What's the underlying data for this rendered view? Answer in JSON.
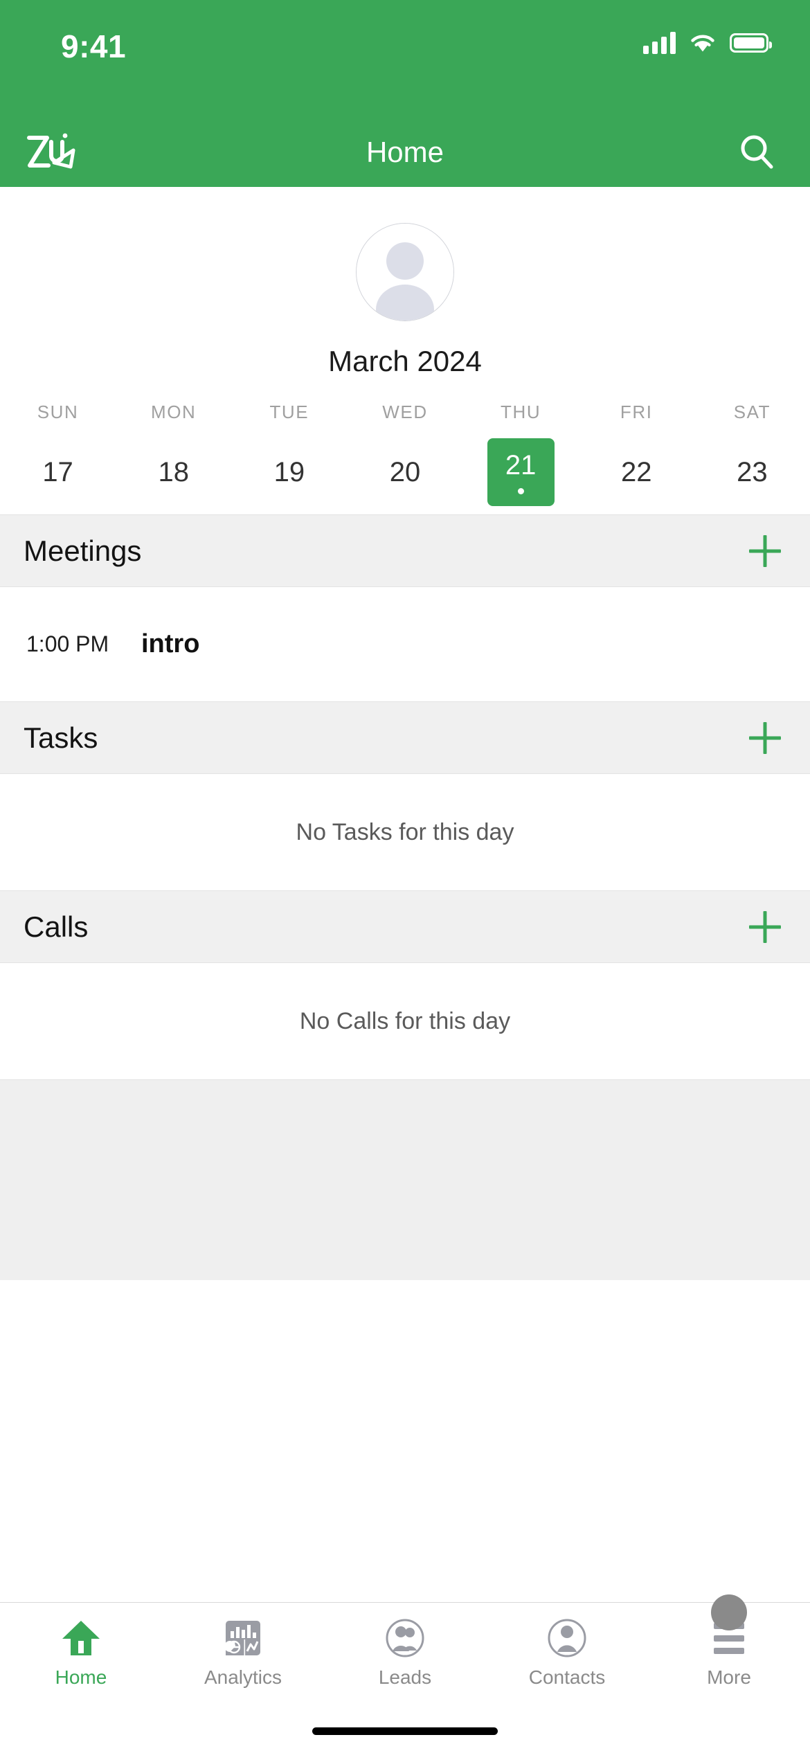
{
  "status_bar": {
    "time": "9:41",
    "cellular_icon": "cellular-signal-icon",
    "wifi_icon": "wifi-icon",
    "battery_icon": "battery-icon"
  },
  "nav": {
    "logo_name": "zia-logo",
    "title": "Home",
    "search_icon": "search-icon"
  },
  "profile": {
    "avatar_name": "default-user-avatar"
  },
  "calendar": {
    "month_label": "March 2024",
    "weekdays": [
      "SUN",
      "MON",
      "TUE",
      "WED",
      "THU",
      "FRI",
      "SAT"
    ],
    "days": [
      {
        "date": "17",
        "selected": false,
        "has_event": false
      },
      {
        "date": "18",
        "selected": false,
        "has_event": false
      },
      {
        "date": "19",
        "selected": false,
        "has_event": false
      },
      {
        "date": "20",
        "selected": false,
        "has_event": false
      },
      {
        "date": "21",
        "selected": true,
        "has_event": true
      },
      {
        "date": "22",
        "selected": false,
        "has_event": false
      },
      {
        "date": "23",
        "selected": false,
        "has_event": false
      }
    ]
  },
  "sections": {
    "meetings": {
      "title": "Meetings",
      "add_label": "+",
      "items": [
        {
          "time": "1:00 PM",
          "title": "intro"
        }
      ]
    },
    "tasks": {
      "title": "Tasks",
      "add_label": "+",
      "empty_text": "No Tasks for this day"
    },
    "calls": {
      "title": "Calls",
      "add_label": "+",
      "empty_text": "No Calls for this day"
    }
  },
  "tabbar": {
    "items": [
      {
        "label": "Home",
        "icon": "home-icon",
        "active": true
      },
      {
        "label": "Analytics",
        "icon": "analytics-icon",
        "active": false
      },
      {
        "label": "Leads",
        "icon": "leads-icon",
        "active": false
      },
      {
        "label": "Contacts",
        "icon": "contacts-icon",
        "active": false
      },
      {
        "label": "More",
        "icon": "more-menu-icon",
        "active": false
      }
    ]
  },
  "colors": {
    "brand_green": "#3AA757",
    "section_bg": "#f0f0f0",
    "inactive_gray": "#8a8a8a"
  }
}
